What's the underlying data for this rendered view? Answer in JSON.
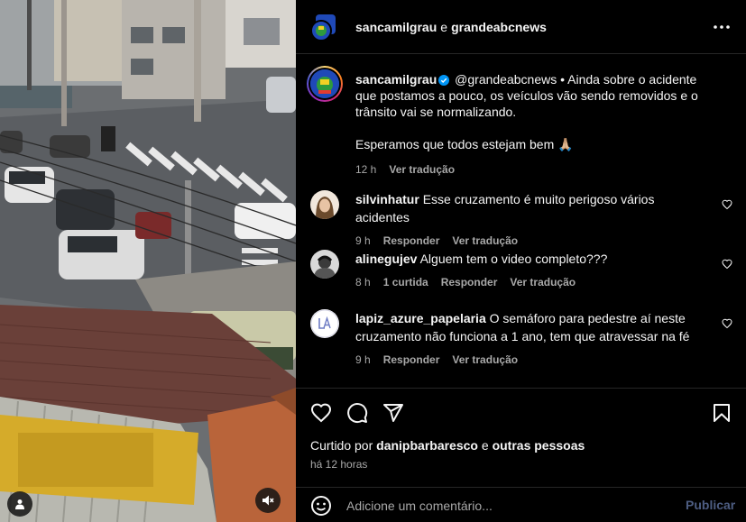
{
  "post": {
    "authors": {
      "primary": "sancamilgrau",
      "separator": "e",
      "secondary": "grandeabcnews"
    },
    "caption": {
      "username": "sancamilgrau",
      "mention": "@grandeabcnews",
      "text": "• Ainda sobre o acidente que postamos a pouco, os veículos vão sendo removidos e o trânsito vai se normalizando.",
      "text2": "Esperamos que todos estejam bem 🙏🏼",
      "time": "12 h",
      "translate": "Ver tradução"
    },
    "comments": [
      {
        "username": "silvinhatur",
        "text": "Esse cruzamento é muito perigoso vários acidentes",
        "time": "9 h",
        "reply": "Responder",
        "translate": "Ver tradução"
      },
      {
        "username": "alinegujev",
        "text": "Alguem tem o video completo???",
        "time": "8 h",
        "likes": "1 curtida",
        "reply": "Responder",
        "translate": "Ver tradução"
      },
      {
        "username": "lapiz_azure_papelaria",
        "text": "O semáforo para pedestre aí neste cruzamento não funciona a 1 ano, tem que atravessar na fé",
        "time": "9 h",
        "reply": "Responder",
        "translate": "Ver tradução"
      }
    ],
    "liked_by": {
      "prefix": "Curtido por",
      "user": "danipbarbaresco",
      "conj": "e",
      "others": "outras pessoas"
    },
    "posted": "há 12 horas",
    "composer": {
      "placeholder": "Adicione um comentário...",
      "submit": "Publicar"
    }
  },
  "icons": {
    "more": "more-options-icon",
    "like": "heart-icon",
    "comment": "comment-icon",
    "share": "share-icon",
    "save": "bookmark-icon",
    "emoji": "emoji-icon",
    "mute": "speaker-muted-icon",
    "tagged": "user-icon",
    "verified": "verified-badge-icon"
  },
  "colors": {
    "accent": "#0095f6",
    "muted_text": "#a8a8a8",
    "publish_disabled": "#4d5d82",
    "background": "#000000"
  }
}
